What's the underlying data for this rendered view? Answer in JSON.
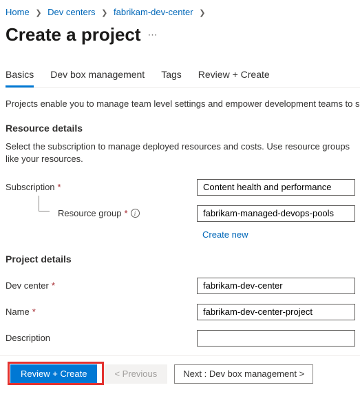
{
  "breadcrumb": {
    "home": "Home",
    "devcenters": "Dev centers",
    "current": "fabrikam-dev-center"
  },
  "title": "Create a project",
  "tabs": {
    "basics": "Basics",
    "devbox": "Dev box management",
    "tags": "Tags",
    "review": "Review + Create"
  },
  "intro": "Projects enable you to manage team level settings and empower development teams to s",
  "resourceDetails": {
    "heading": "Resource details",
    "sub": "Select the subscription to manage deployed resources and costs. Use resource groups like your resources.",
    "subscriptionLabel": "Subscription",
    "subscriptionValue": "Content health and performance",
    "resourceGroupLabel": "Resource group",
    "resourceGroupValue": "fabrikam-managed-devops-pools",
    "createNew": "Create new"
  },
  "projectDetails": {
    "heading": "Project details",
    "devCenterLabel": "Dev center",
    "devCenterValue": "fabrikam-dev-center",
    "nameLabel": "Name",
    "nameValue": "fabrikam-dev-center-project",
    "descriptionLabel": "Description",
    "descriptionValue": ""
  },
  "footer": {
    "review": "Review + Create",
    "previous": "< Previous",
    "next": "Next : Dev box management >"
  }
}
